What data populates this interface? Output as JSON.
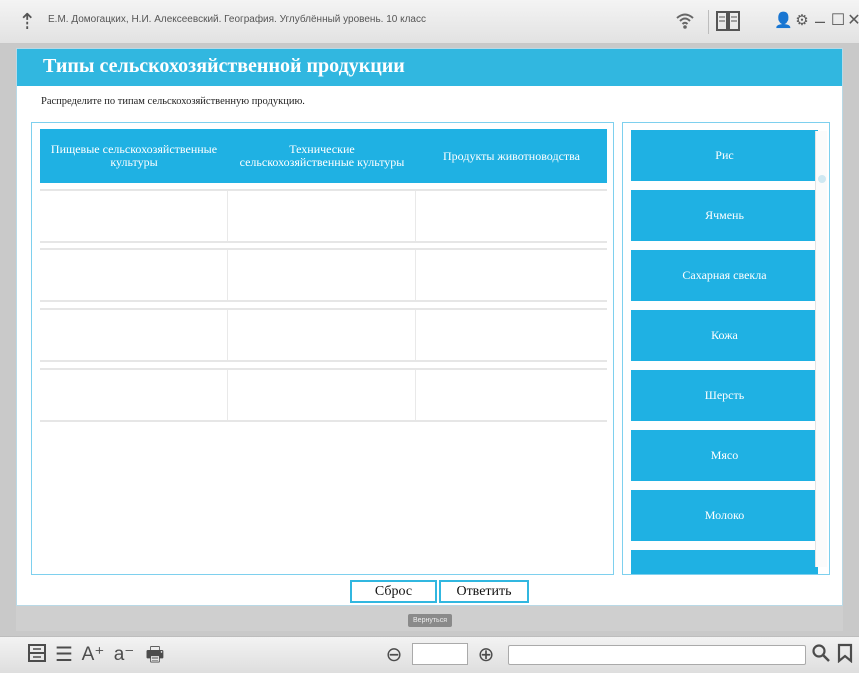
{
  "window": {
    "title": "Е.М. Домогацких, Н.И. Алексеевский. География. Углублённый уровень. 10 класс",
    "icons": [
      "app-logo-icon",
      "wifi-icon",
      "book-icon",
      "user-icon",
      "gear-icon",
      "minimize-icon",
      "maximize-icon",
      "close-icon"
    ]
  },
  "exercise": {
    "title": "Типы сельскохозяйственной продукции",
    "instruction": "Распределите по типам сельскохозяйственную продукцию.",
    "columns": [
      "Пищевые сельскохозяйственные культуры",
      "Технические сельскохозяйственные культуры",
      "Продукты животноводства"
    ],
    "drop_rows": 4,
    "cards": [
      "Рис",
      "Ячмень",
      "Сахарная свекла",
      "Кожа",
      "Шерсть",
      "Мясо",
      "Молоко",
      ""
    ],
    "reset_label": "Сброс",
    "answer_label": "Ответить",
    "back_label": "Вернуться"
  },
  "toolbar": {
    "page_value": "",
    "search_value": ""
  },
  "colors": {
    "accent": "#31b7e0",
    "card": "#1fb1e3",
    "border": "#7ed0ee"
  }
}
